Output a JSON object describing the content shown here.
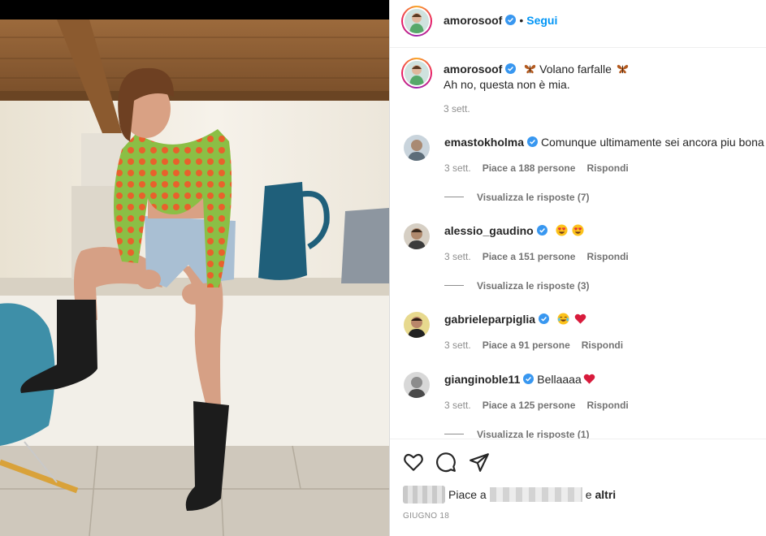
{
  "post": {
    "author": "amorosoof",
    "follow_label": "Segui",
    "dot": "•"
  },
  "caption": {
    "author": "amorosoof",
    "line1": "Volano farfalle",
    "line2": "Ah no, questa non è mia.",
    "age": "3 sett.",
    "emoji": "butterfly-emoji"
  },
  "comments": [
    {
      "username": "emastokholma",
      "text": "Comunque ultimamente sei ancora piu bona",
      "age": "3 sett.",
      "likes": "Piace a 188 persone",
      "reply": "Rispondi",
      "view_replies": "Visualizza le risposte (7)",
      "emoji": []
    },
    {
      "username": "alessio_gaudino",
      "text": "",
      "age": "3 sett.",
      "likes": "Piace a 151 persone",
      "reply": "Rispondi",
      "view_replies": "Visualizza le risposte (3)",
      "emoji": [
        "heart-eyes-emoji",
        "heart-eyes-emoji"
      ]
    },
    {
      "username": "gabrieleparpiglia",
      "text": "",
      "age": "3 sett.",
      "likes": "Piace a 91 persone",
      "reply": "Rispondi",
      "emoji": [
        "tears-of-joy-emoji",
        "red-heart-emoji"
      ]
    },
    {
      "username": "gianginoble11",
      "text": "Bellaaaa",
      "age": "3 sett.",
      "likes": "Piace a 125 persone",
      "reply": "Rispondi",
      "view_replies": "Visualizza le risposte (1)",
      "emoji": [
        "red-heart-emoji"
      ]
    }
  ],
  "footer": {
    "likes_prefix": "Piace a",
    "likes_and": "e",
    "likes_others": "altri",
    "date": "GIUGNO 18"
  },
  "colors": {
    "accent": "#0095f6",
    "verified": "#3897f0",
    "muted": "#8e8e8e"
  }
}
